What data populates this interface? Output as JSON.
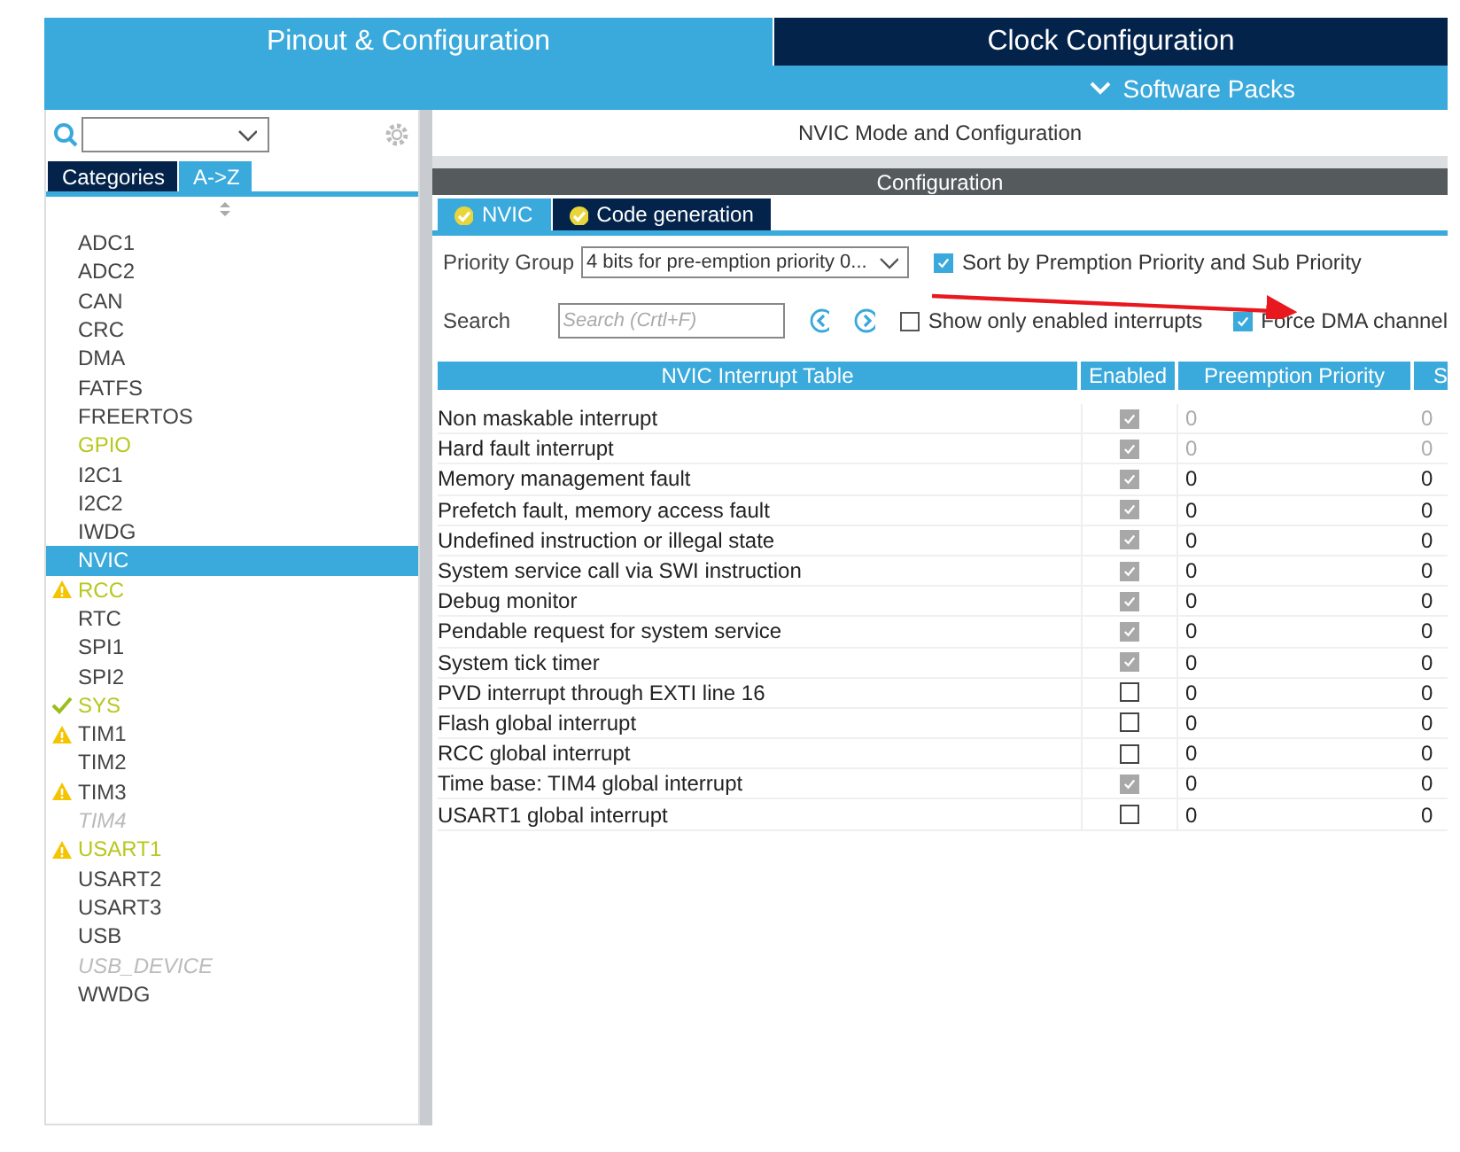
{
  "top_tabs": [
    {
      "label": "Pinout & Configuration",
      "selected": true
    },
    {
      "label": "Clock Configuration",
      "selected": false
    }
  ],
  "software_packs": {
    "label": "Software Packs"
  },
  "sidebar": {
    "view_tabs": [
      {
        "label": "Categories",
        "selected": false
      },
      {
        "label": "A->Z",
        "selected": true
      }
    ],
    "items": [
      {
        "label": "ADC1",
        "warning": false,
        "ok": false,
        "configured": false,
        "disabled": false,
        "selected": false
      },
      {
        "label": "ADC2",
        "warning": false,
        "ok": false,
        "configured": false,
        "disabled": false,
        "selected": false
      },
      {
        "label": "CAN",
        "warning": false,
        "ok": false,
        "configured": false,
        "disabled": false,
        "selected": false
      },
      {
        "label": "CRC",
        "warning": false,
        "ok": false,
        "configured": false,
        "disabled": false,
        "selected": false
      },
      {
        "label": "DMA",
        "warning": false,
        "ok": false,
        "configured": false,
        "disabled": false,
        "selected": false
      },
      {
        "label": "FATFS",
        "warning": false,
        "ok": false,
        "configured": false,
        "disabled": false,
        "selected": false
      },
      {
        "label": "FREERTOS",
        "warning": false,
        "ok": false,
        "configured": false,
        "disabled": false,
        "selected": false
      },
      {
        "label": "GPIO",
        "warning": false,
        "ok": false,
        "configured": true,
        "disabled": false,
        "selected": false
      },
      {
        "label": "I2C1",
        "warning": false,
        "ok": false,
        "configured": false,
        "disabled": false,
        "selected": false
      },
      {
        "label": "I2C2",
        "warning": false,
        "ok": false,
        "configured": false,
        "disabled": false,
        "selected": false
      },
      {
        "label": "IWDG",
        "warning": false,
        "ok": false,
        "configured": false,
        "disabled": false,
        "selected": false
      },
      {
        "label": "NVIC",
        "warning": false,
        "ok": false,
        "configured": false,
        "disabled": false,
        "selected": true
      },
      {
        "label": "RCC",
        "warning": true,
        "ok": false,
        "configured": true,
        "disabled": false,
        "selected": false
      },
      {
        "label": "RTC",
        "warning": false,
        "ok": false,
        "configured": false,
        "disabled": false,
        "selected": false
      },
      {
        "label": "SPI1",
        "warning": false,
        "ok": false,
        "configured": false,
        "disabled": false,
        "selected": false
      },
      {
        "label": "SPI2",
        "warning": false,
        "ok": false,
        "configured": false,
        "disabled": false,
        "selected": false
      },
      {
        "label": "SYS",
        "warning": false,
        "ok": true,
        "configured": true,
        "disabled": false,
        "selected": false
      },
      {
        "label": "TIM1",
        "warning": true,
        "ok": false,
        "configured": false,
        "disabled": false,
        "selected": false
      },
      {
        "label": "TIM2",
        "warning": false,
        "ok": false,
        "configured": false,
        "disabled": false,
        "selected": false
      },
      {
        "label": "TIM3",
        "warning": true,
        "ok": false,
        "configured": false,
        "disabled": false,
        "selected": false
      },
      {
        "label": "TIM4",
        "warning": false,
        "ok": false,
        "configured": false,
        "disabled": true,
        "selected": false
      },
      {
        "label": "USART1",
        "warning": true,
        "ok": false,
        "configured": true,
        "disabled": false,
        "selected": false
      },
      {
        "label": "USART2",
        "warning": false,
        "ok": false,
        "configured": false,
        "disabled": false,
        "selected": false
      },
      {
        "label": "USART3",
        "warning": false,
        "ok": false,
        "configured": false,
        "disabled": false,
        "selected": false
      },
      {
        "label": "USB",
        "warning": false,
        "ok": false,
        "configured": false,
        "disabled": false,
        "selected": false
      },
      {
        "label": "USB_DEVICE",
        "warning": false,
        "ok": false,
        "configured": false,
        "disabled": true,
        "selected": false
      },
      {
        "label": "WWDG",
        "warning": false,
        "ok": false,
        "configured": false,
        "disabled": false,
        "selected": false
      }
    ]
  },
  "panel": {
    "title": "NVIC Mode and Configuration",
    "section": "Configuration",
    "tabs": [
      {
        "label": "NVIC",
        "selected": true
      },
      {
        "label": "Code generation",
        "selected": false
      }
    ],
    "priority_group": {
      "label": "Priority Group",
      "value": "4 bits for pre-emption priority 0..."
    },
    "sort_option": {
      "label": "Sort by Premption Priority and Sub Priority",
      "checked": true
    },
    "search": {
      "label": "Search",
      "placeholder": "Search (Crtl+F)"
    },
    "show_enabled_option": {
      "label": "Show only enabled interrupts",
      "checked": false
    },
    "force_dma_option": {
      "label": "Force DMA channel",
      "checked": true
    }
  },
  "table": {
    "columns": [
      "NVIC Interrupt Table",
      "Enabled",
      "Preemption Priority",
      "S"
    ],
    "rows": [
      {
        "name": "Non maskable interrupt",
        "enabled": true,
        "locked": true,
        "preemption": "0",
        "column_4": "0"
      },
      {
        "name": "Hard fault interrupt",
        "enabled": true,
        "locked": true,
        "preemption": "0",
        "column_4": "0"
      },
      {
        "name": "Memory management fault",
        "enabled": true,
        "locked": false,
        "preemption": "0",
        "column_4": "0"
      },
      {
        "name": "Prefetch fault, memory access fault",
        "enabled": true,
        "locked": false,
        "preemption": "0",
        "column_4": "0"
      },
      {
        "name": "Undefined instruction or illegal state",
        "enabled": true,
        "locked": false,
        "preemption": "0",
        "column_4": "0"
      },
      {
        "name": "System service call via SWI instruction",
        "enabled": true,
        "locked": false,
        "preemption": "0",
        "column_4": "0"
      },
      {
        "name": "Debug monitor",
        "enabled": true,
        "locked": false,
        "preemption": "0",
        "column_4": "0"
      },
      {
        "name": "Pendable request for system service",
        "enabled": true,
        "locked": false,
        "preemption": "0",
        "column_4": "0"
      },
      {
        "name": "System tick timer",
        "enabled": true,
        "locked": false,
        "preemption": "0",
        "column_4": "0"
      },
      {
        "name": "PVD interrupt through EXTI line 16",
        "enabled": false,
        "locked": false,
        "preemption": "0",
        "column_4": "0"
      },
      {
        "name": "Flash global interrupt",
        "enabled": false,
        "locked": false,
        "preemption": "0",
        "column_4": "0"
      },
      {
        "name": "RCC global interrupt",
        "enabled": false,
        "locked": false,
        "preemption": "0",
        "column_4": "0"
      },
      {
        "name": "Time base: TIM4 global interrupt",
        "enabled": true,
        "locked": false,
        "preemption": "0",
        "column_4": "0"
      },
      {
        "name": "USART1 global interrupt",
        "enabled": false,
        "locked": false,
        "preemption": "0",
        "column_4": "0"
      }
    ]
  }
}
